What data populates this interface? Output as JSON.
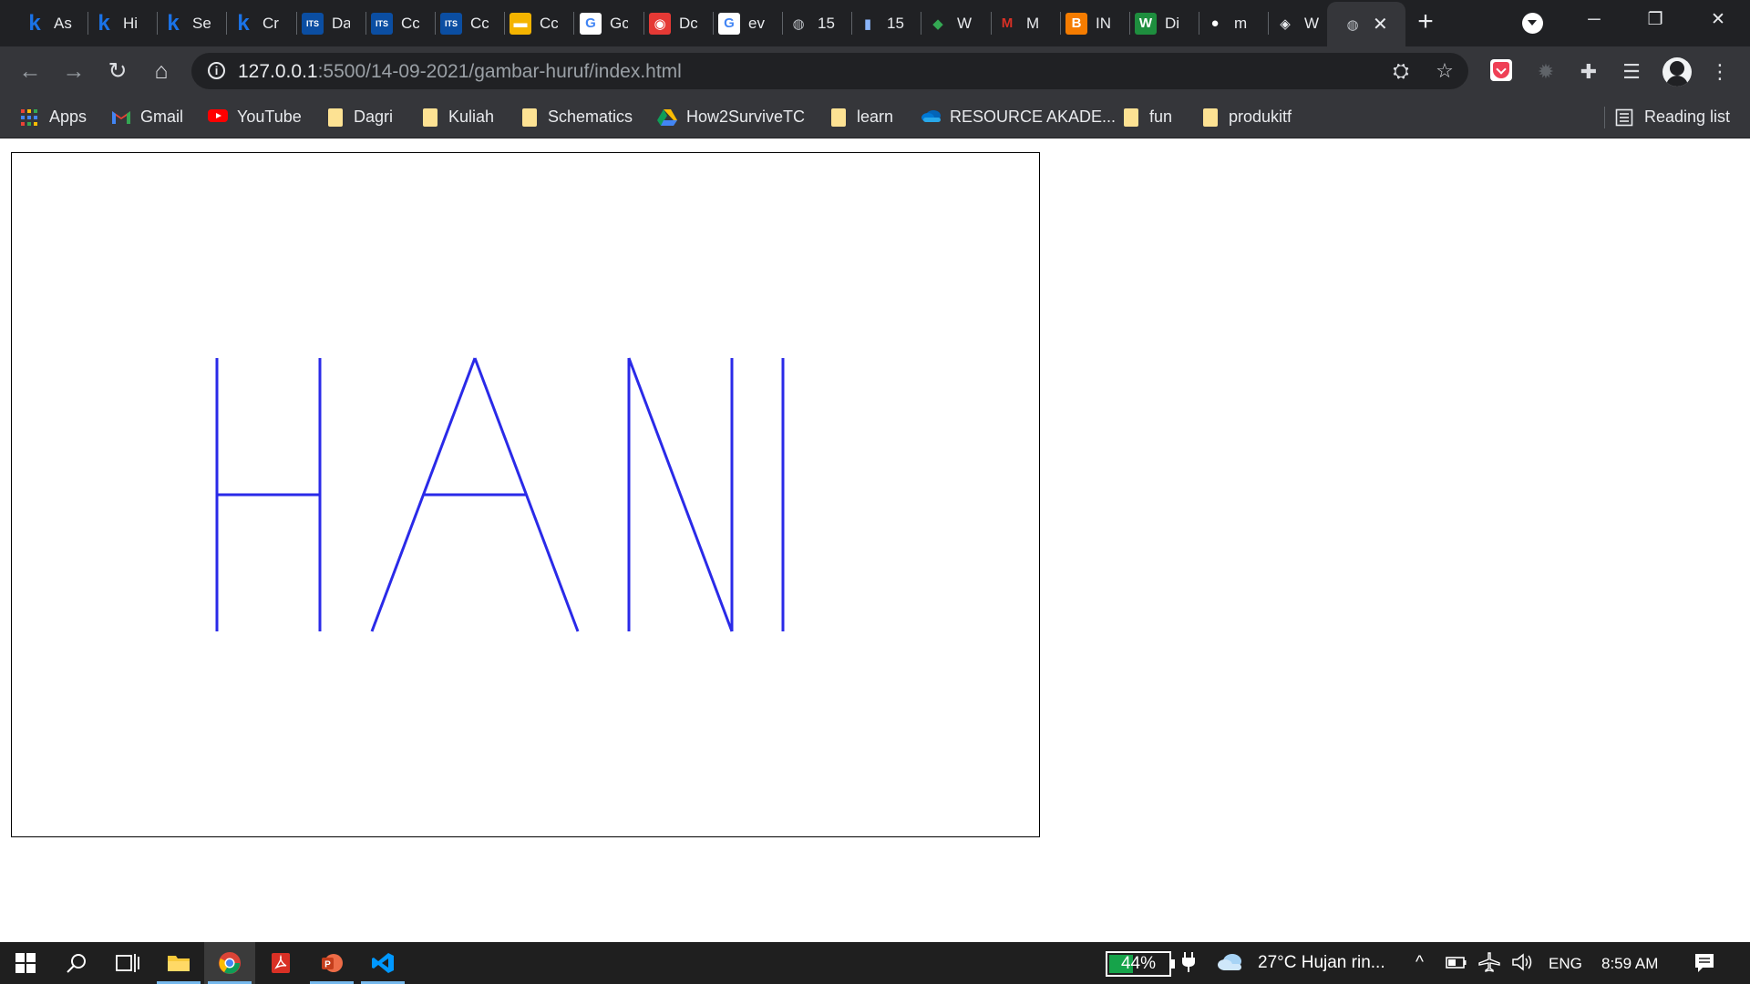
{
  "browser": {
    "tabs": [
      {
        "icon": "k",
        "title": "As",
        "color": "#1a73e8",
        "bg": "transparent"
      },
      {
        "icon": "k",
        "title": "Hi",
        "color": "#1a73e8",
        "bg": "transparent"
      },
      {
        "icon": "k",
        "title": "Se",
        "color": "#1a73e8",
        "bg": "transparent"
      },
      {
        "icon": "k",
        "title": "Cr",
        "color": "#1a73e8",
        "bg": "transparent"
      },
      {
        "icon": "ITS",
        "title": "Da",
        "color": "#ffffff",
        "bg": "#0b4ea2"
      },
      {
        "icon": "ITS",
        "title": "Cc",
        "color": "#ffffff",
        "bg": "#0b4ea2"
      },
      {
        "icon": "ITS",
        "title": "Cc",
        "color": "#ffffff",
        "bg": "#0b4ea2"
      },
      {
        "icon": "▬",
        "title": "Cc",
        "color": "#ffffff",
        "bg": "#f4b400"
      },
      {
        "icon": "G",
        "title": "Gc",
        "color": "#4285f4",
        "bg": "#ffffff"
      },
      {
        "icon": "◉",
        "title": "Dc",
        "color": "#ffffff",
        "bg": "#e53935"
      },
      {
        "icon": "G",
        "title": "ev",
        "color": "#4285f4",
        "bg": "#ffffff"
      },
      {
        "icon": "◍",
        "title": "15",
        "color": "#bdc1c6",
        "bg": "transparent"
      },
      {
        "icon": "▮",
        "title": "15",
        "color": "#8ab4f8",
        "bg": "transparent"
      },
      {
        "icon": "◆",
        "title": "W",
        "color": "#34a853",
        "bg": "transparent"
      },
      {
        "icon": "M",
        "title": "M",
        "color": "#d93025",
        "bg": "transparent"
      },
      {
        "icon": "B",
        "title": "IN",
        "color": "#ffffff",
        "bg": "#f57c00"
      },
      {
        "icon": "W",
        "title": "Di",
        "color": "#ffffff",
        "bg": "#1e8e3e"
      },
      {
        "icon": "●",
        "title": "m",
        "color": "#ffffff",
        "bg": "transparent"
      },
      {
        "icon": "◈",
        "title": "W",
        "color": "#e8eaed",
        "bg": "transparent"
      }
    ],
    "active_tab": {
      "icon": "◍",
      "title": ""
    },
    "url_host": "127.0.0.1",
    "url_rest": ":5500/14-09-2021/gambar-huruf/index.html",
    "bookmarks": [
      {
        "label": "Apps",
        "icon": "apps-grid-icon"
      },
      {
        "label": "Gmail",
        "icon": "gmail-icon"
      },
      {
        "label": "YouTube",
        "icon": "youtube-icon"
      },
      {
        "label": "Dagri",
        "icon": "folder-icon"
      },
      {
        "label": "Kuliah",
        "icon": "folder-icon"
      },
      {
        "label": "Schematics",
        "icon": "folder-icon"
      },
      {
        "label": "How2SurviveTC",
        "icon": "google-drive-icon"
      },
      {
        "label": "learn",
        "icon": "folder-icon"
      },
      {
        "label": "RESOURCE AKADE...",
        "icon": "onedrive-icon"
      },
      {
        "label": "fun",
        "icon": "folder-icon"
      },
      {
        "label": "produkitf",
        "icon": "folder-icon"
      }
    ],
    "reading_list": "Reading list"
  },
  "canvas": {
    "stroke_color": "#2a2ae8",
    "letters": "HANI"
  },
  "taskbar": {
    "battery_percent": 44,
    "battery_label": "44%",
    "weather": "27°C  Hujan rin...",
    "language": "ENG",
    "time": "8:59 AM"
  }
}
